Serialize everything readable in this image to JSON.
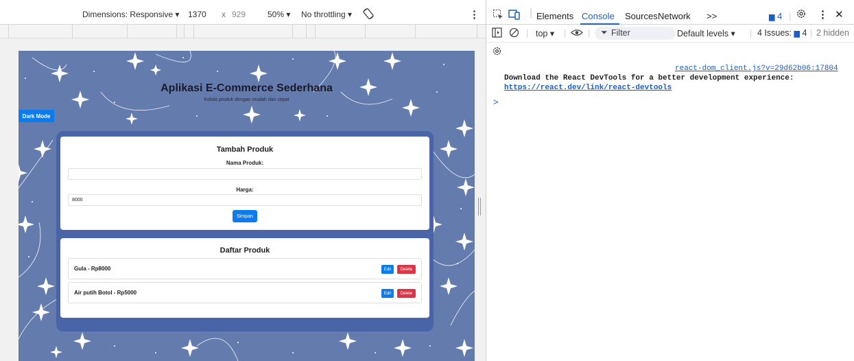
{
  "toolbar": {
    "dimensions_label": "Dimensions: Responsive",
    "width": "1370",
    "times": "x",
    "height": "929",
    "zoom": "50%",
    "throttling": "No throttling"
  },
  "app": {
    "title": "Aplikasi E-Commerce Sederhana",
    "subtitle": "Kelola produk dengan mudah dan cepat",
    "dark_mode_button": "Dark Mode",
    "form": {
      "heading": "Tambah Produk",
      "name_label": "Nama Produk:",
      "name_value": "",
      "price_label": "Harga:",
      "price_value": "8000",
      "save_button": "Simpan"
    },
    "list": {
      "heading": "Daftar Produk",
      "edit_label": "Edit",
      "delete_label": "Delete",
      "items": [
        {
          "label": "Gula - Rp8000"
        },
        {
          "label": "Air putih Botol - Rp5000"
        }
      ]
    }
  },
  "devtools": {
    "tabs": [
      "Elements",
      "Console",
      "Sources",
      "Network"
    ],
    "active_tab": "Console",
    "more_tabs": ">>",
    "messages_count": "4",
    "context": "top",
    "filter_placeholder": "Filter",
    "levels": "Default levels",
    "issues_label": "4 Issues:",
    "issues_count": "4",
    "hidden": "2 hidden",
    "console": {
      "source": "react-dom_client.js?v=29d62b06:17804",
      "message": "Download the React DevTools for a better development experience:",
      "link": "https://react.dev/link/react-devtools",
      "prompt": ">"
    }
  },
  "colors": {
    "page_bg": "#647bae",
    "container_bg": "#4a64a8",
    "primary": "#0a7cf0",
    "danger": "#dc3545",
    "devtools_accent": "#1a5fc7"
  }
}
